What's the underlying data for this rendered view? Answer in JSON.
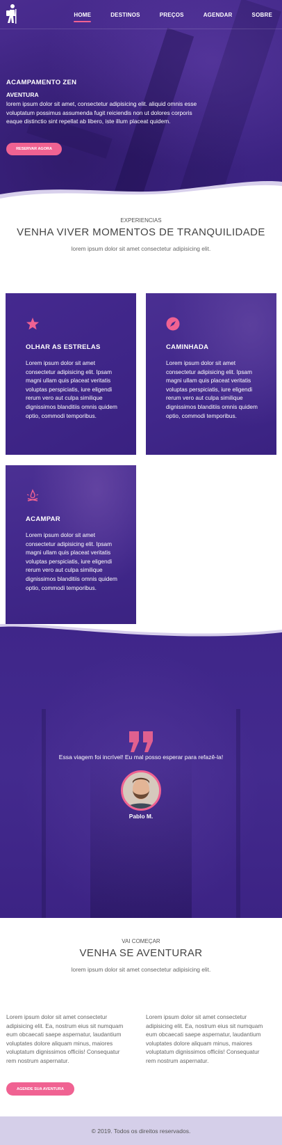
{
  "nav": {
    "items": [
      {
        "label": "HOME",
        "active": true
      },
      {
        "label": "DESTINOS",
        "active": false
      },
      {
        "label": "PREÇOS",
        "active": false
      },
      {
        "label": "AGENDAR",
        "active": false
      },
      {
        "label": "SOBRE",
        "active": false
      }
    ],
    "logo_icon": "hiker-icon"
  },
  "hero": {
    "title": "ACAMPAMENTO ZEN",
    "subtitle": "AVENTURA",
    "text": "lorem ipsum dolor sit amet, consectetur adipisicing elit. aliquid omnis esse voluptatum possimus assumenda fugit reiciendis non ut dolores corporis eaque distinctio sint repellat ab libero, iste illum placeat quidem.",
    "button": "RESERVAR AGORA"
  },
  "experiences": {
    "eyebrow": "EXPERIENCIAS",
    "title": "VENHA VIVER MOMENTOS DE TRANQUILIDADE",
    "description": "lorem ipsum dolor sit amet consectetur adipisicing elit.",
    "cards": [
      {
        "icon": "star-icon",
        "title": "OLHAR AS ESTRELAS",
        "text": "Lorem ipsum dolor sit amet consectetur adipisicing elit. Ipsam magni ullam quis placeat veritatis voluptas perspiciatis, iure eligendi rerum vero aut culpa similique dignissimos blanditiis omnis quidem optio, commodi temporibus."
      },
      {
        "icon": "compass-icon",
        "title": "CAMINHADA",
        "text": "Lorem ipsum dolor sit amet consectetur adipisicing elit. Ipsam magni ullam quis placeat veritatis voluptas perspiciatis, iure eligendi rerum vero aut culpa similique dignissimos blanditiis omnis quidem optio, commodi temporibus."
      },
      {
        "icon": "campfire-icon",
        "title": "ACAMPAR",
        "text": "Lorem ipsum dolor sit amet consectetur adipisicing elit. Ipsam magni ullam quis placeat veritatis voluptas perspiciatis, iure eligendi rerum vero aut culpa similique dignissimos blanditiis omnis quidem optio, commodi temporibus."
      }
    ]
  },
  "testimonial": {
    "quote_icon": "quote-icon",
    "quote": "Essa viagem foi incrível! Eu mal posso esperar para refazê-la!",
    "author": "Pablo M."
  },
  "adventure": {
    "eyebrow": "VAI COMEÇAR",
    "title": "VENHA SE AVENTURAR",
    "description": "lorem ipsum dolor sit amet consectetur adipisicing elit.",
    "col1": "Lorem ipsum dolor sit amet consectetur adipisicing elit. Ea, nostrum eius sit numquam eum obcaecati saepe aspernatur, laudantium voluptates dolore aliquam minus, maiores voluptatum dignissimos officiis! Consequatur rem nostrum aspernatur.",
    "col2": "Lorem ipsum dolor sit amet consectetur adipisicing elit. Ea, nostrum eius sit numquam eum obcaecati saepe aspernatur, laudantium voluptates dolore aliquam minus, maiores voluptatum dignissimos officiis! Consequatur rem nostrum aspernatur.",
    "button": "AGENDE SUA AVENTURA"
  },
  "footer": {
    "text": "© 2019. Todos os direitos reservados."
  },
  "colors": {
    "accent": "#f06292",
    "purple": "#3f2689",
    "footer_bg": "#d5cfe9"
  }
}
